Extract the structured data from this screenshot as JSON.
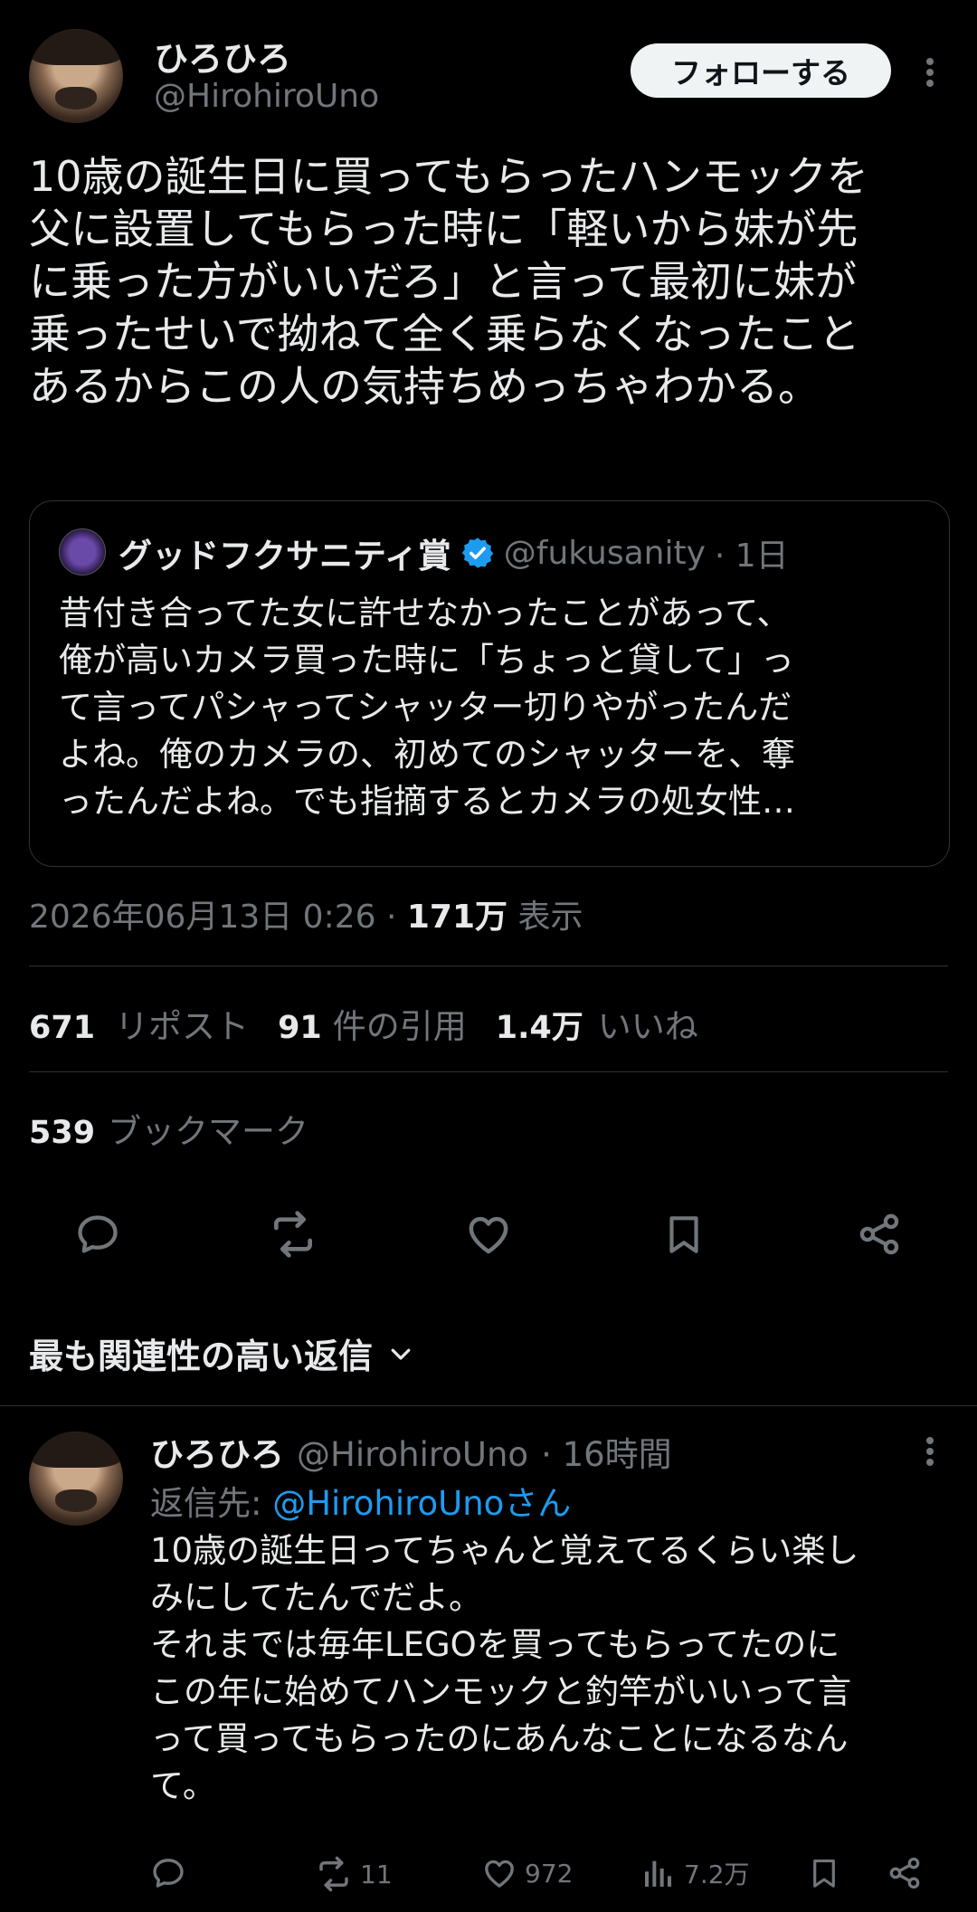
{
  "tweet": {
    "author_name": "ひろひろ",
    "author_handle": "@HirohiroUno",
    "follow_label": "フォローする",
    "text": "10歳の誕生日に買ってもらったハンモックを\n父に設置してもらった時に「軽いから妹が先\nに乗った方がいいだろ」と言って最初に妹が\n乗ったせいで拗ねて全く乗らなくなったこと\nあるからこの人の気持ちめっちゃわかる。",
    "quote": {
      "name": "グッドフクサニティ賞",
      "handle": "@fukusanity",
      "time": "· 1日",
      "text": "昔付き合ってた女に許せなかったことがあって、\n俺が高いカメラ買った時に「ちょっと貸して」っ\nて言ってパシャってシャッター切りやがったんだ\nよね。俺のカメラの、初めてのシャッターを、奪\nったんだよね。でも指摘するとカメラの処女性…"
    },
    "timestamp": "2026年06月13日 0:26 ·",
    "views_num": "171万",
    "views_label": "表示",
    "stats": {
      "reposts_num": "671",
      "reposts_label": "リポスト",
      "quotes_num": "91",
      "quotes_label": "件の引用",
      "likes_num": "1.4万",
      "likes_label": "いいね",
      "bookmarks_num": "539",
      "bookmarks_label": "ブックマーク"
    },
    "icons": [
      "reply-icon",
      "retweet-icon",
      "like-icon",
      "bookmark-icon",
      "share-icon"
    ]
  },
  "replies_section": {
    "title": "最も関連性の高い返信"
  },
  "reply": {
    "author_name": "ひろひろ",
    "author_handle": "@HirohiroUno",
    "time": "· 16時間",
    "reply_to_prefix": "返信先: ",
    "reply_to_link": "@HirohiroUnoさん",
    "text": "10歳の誕生日ってちゃんと覚えてるくらい楽し\nみにしてたんでだよ。\nそれまでは毎年LEGOを買ってもらってたのに\nこの年に始めてハンモックと釣竿がいいって言\nって買ってもらったのにあんなことになるなん\nて。",
    "retweets": "11",
    "likes": "972",
    "views": "7.2万"
  },
  "colors": {
    "background": "#000000",
    "text": "#e7e9ea",
    "muted": "#71767b",
    "link": "#1d9bf0",
    "divider": "#2f3336",
    "verified": "#1d9bf0"
  }
}
